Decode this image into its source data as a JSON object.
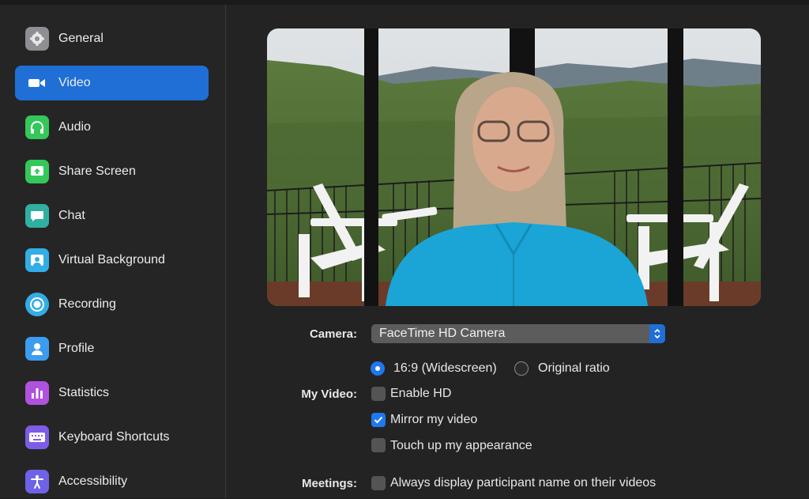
{
  "sidebar": {
    "items": [
      {
        "label": "General",
        "icon": "gear-icon",
        "color": "#8e8e93",
        "active": false
      },
      {
        "label": "Video",
        "icon": "video-camera-icon",
        "color": "#1f6fd6",
        "active": true
      },
      {
        "label": "Audio",
        "icon": "headphones-icon",
        "color": "#34c759",
        "active": false
      },
      {
        "label": "Share Screen",
        "icon": "share-screen-icon",
        "color": "#34c759",
        "active": false
      },
      {
        "label": "Chat",
        "icon": "chat-bubble-icon",
        "color": "#30b0a0",
        "active": false
      },
      {
        "label": "Virtual Background",
        "icon": "person-portrait-icon",
        "color": "#32ade6",
        "active": false
      },
      {
        "label": "Recording",
        "icon": "record-icon",
        "color": "#32ade6",
        "active": false
      },
      {
        "label": "Profile",
        "icon": "person-icon",
        "color": "#3b9cf0",
        "active": false
      },
      {
        "label": "Statistics",
        "icon": "bar-chart-icon",
        "color": "#af52de",
        "active": false
      },
      {
        "label": "Keyboard Shortcuts",
        "icon": "keyboard-icon",
        "color": "#7d5ce6",
        "active": false
      },
      {
        "label": "Accessibility",
        "icon": "accessibility-icon",
        "color": "#6e62e6",
        "active": false
      }
    ]
  },
  "video": {
    "camera_label": "Camera:",
    "camera_value": "FaceTime HD Camera",
    "my_video_label": "My Video:",
    "ratio_widescreen": "16:9 (Widescreen)",
    "ratio_original": "Original ratio",
    "enable_hd": "Enable HD",
    "mirror": "Mirror my video",
    "touch_up": "Touch up my appearance",
    "meetings_label": "Meetings:",
    "always_display_names": "Always display participant name on their videos",
    "state": {
      "widescreen": true,
      "enable_hd": false,
      "mirror": true,
      "touch_up": false,
      "always_display_names": false
    }
  },
  "colors": {
    "accent": "#1f6fd6",
    "background": "#232323",
    "sidebar": "#252526"
  }
}
